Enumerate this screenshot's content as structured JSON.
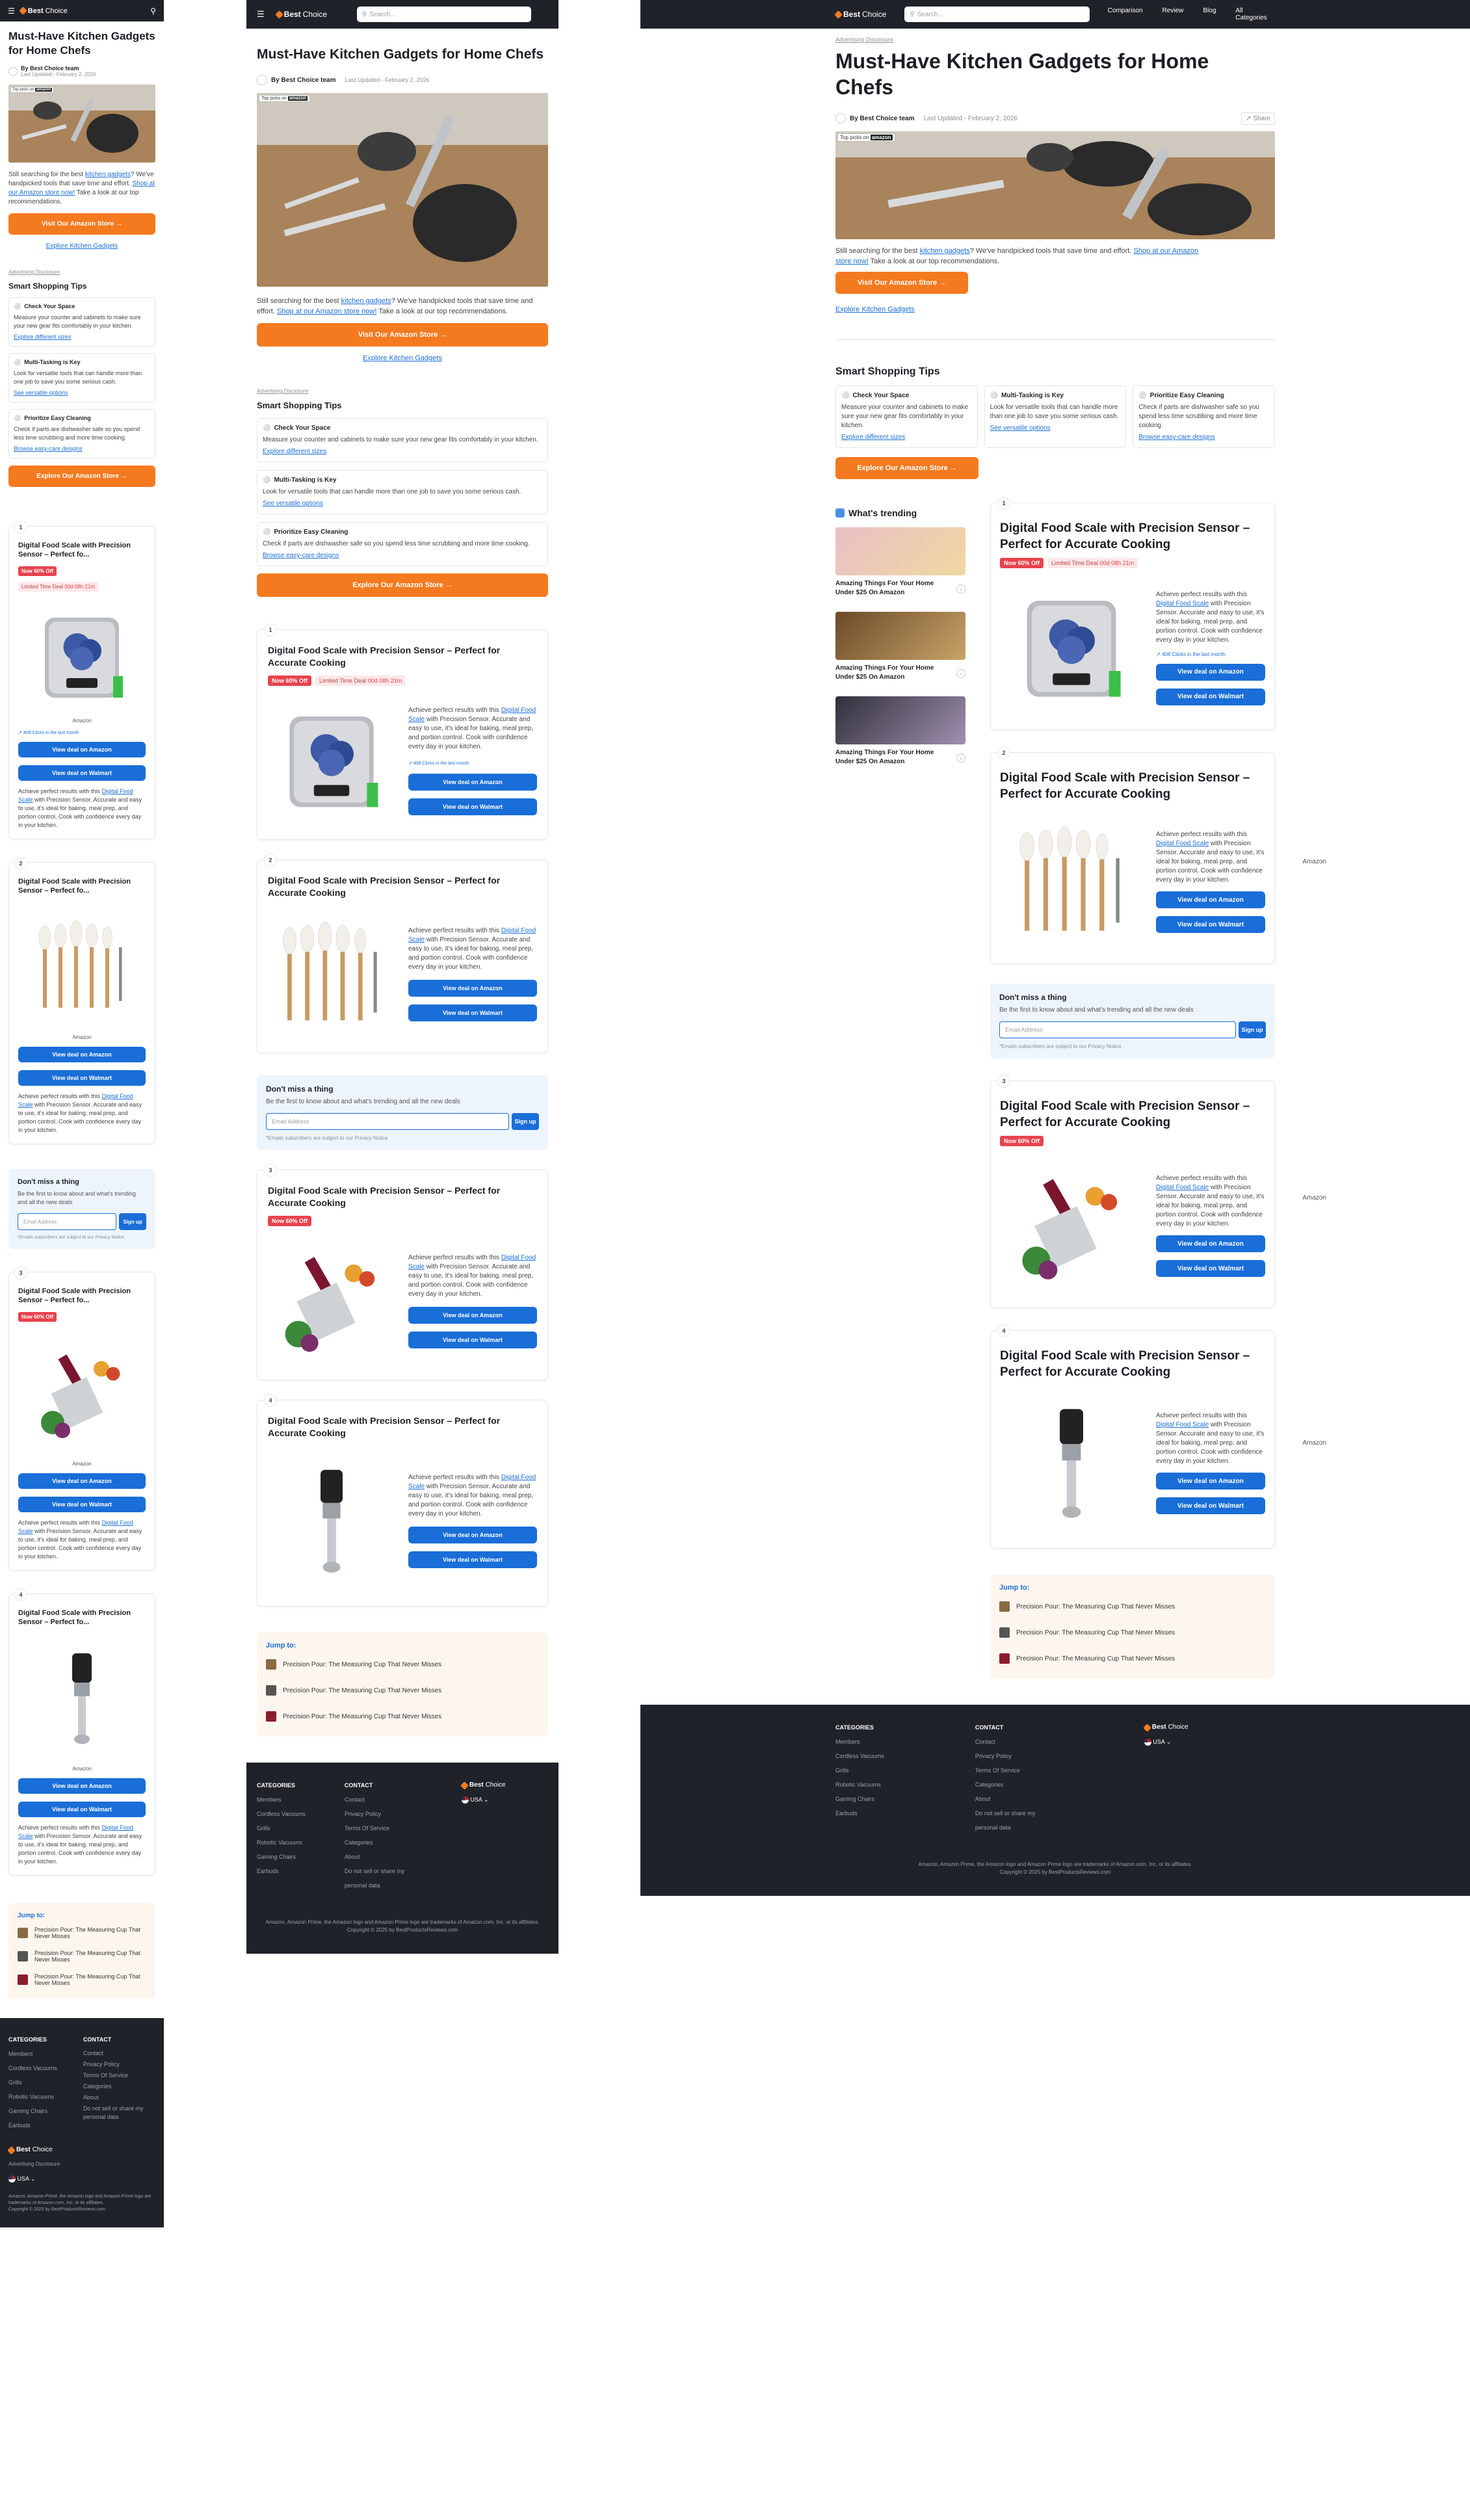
{
  "brand": {
    "name_bold": "Best",
    "name_light": "Choice"
  },
  "search": {
    "placeholder": "Search..."
  },
  "nav": [
    "Comparison",
    "Review",
    "Blog",
    "All Categories"
  ],
  "ad_disclosure": "Advertising Disclosure",
  "article": {
    "title": "Must-Have Kitchen Gadgets for Home Chefs",
    "author": "By Best Choice team",
    "updated": "Last Updated - February 2, 2026",
    "share": "Share",
    "top_picks": "Top picks on",
    "amazon_tag": "amazon",
    "intro_a": "Still searching for the best ",
    "intro_link1": "kitchen gadgets",
    "intro_b": "? We've handpicked tools that save time and effort. ",
    "intro_link2": "Shop at our Amazon store now!",
    "intro_c": " Take a look at our top recommendations.",
    "cta": "Visit Our Amazon Store →",
    "explore_link": "Explore Kitchen Gadgets"
  },
  "tips": {
    "heading": "Smart Shopping Tips",
    "items": [
      {
        "title": "Check Your Space",
        "text": "Measure your counter and cabinets to make sure your new gear fits comfortably in your kitchen.",
        "link": "Explore different sizes"
      },
      {
        "title": "Multi-Tasking is Key",
        "text": "Look for versatile tools that can handle more than one job to save you some serious cash.",
        "link": "See versatile options"
      },
      {
        "title": "Prioritize Easy Cleaning",
        "text": "Check if parts are dishwasher safe so you spend less time scrubbing and more time cooking.",
        "link": "Browse easy-care designs"
      }
    ],
    "cta": "Explore Our Amazon Store →"
  },
  "trending": {
    "heading": "What's trending",
    "items": [
      "Amazing Things For Your Home Under $25 On Amazon",
      "Amazing Things For Your Home Under $25 On Amazon",
      "Amazing Things For Your Home Under $25 On Amazon"
    ]
  },
  "products": [
    {
      "rank": "1",
      "title": "Digital Food Scale with Precision Sensor – Perfect for Accurate Cooking",
      "short": "Digital Food Scale with Precision Sensor – Perfect fo...",
      "badge": "Now 60% Off",
      "deal": "Limited Time Deal",
      "timer": "00d 08h 21m",
      "clicks": "408 Clicks in the last month",
      "brand": "Amazon",
      "desc_a": "Achieve perfect results with this ",
      "desc_link": "Digital Food Scale",
      "desc_b": " with Precision Sensor. Accurate and easy to use, it's ideal for baking, meal prep, and portion control. Cook with confidence every day in your kitchen.",
      "btn_amazon": "View deal on Amazon",
      "btn_walmart": "View deal on Walmart"
    },
    {
      "rank": "2",
      "title": "Digital Food Scale with Precision Sensor – Perfect for Accurate Cooking",
      "short": "Digital Food Scale with Precision Sensor – Perfect fo...",
      "brand": "Amazon",
      "desc_a": "Achieve perfect results with this ",
      "desc_link": "Digital Food Scale",
      "desc_b": " with Precision Sensor. Accurate and easy to use, it's ideal for baking, meal prep, and portion control. Cook with confidence every day in your kitchen.",
      "btn_amazon": "View deal on Amazon",
      "btn_walmart": "View deal on Walmart"
    },
    {
      "rank": "3",
      "title": "Digital Food Scale with Precision Sensor – Perfect for Accurate Cooking",
      "short": "Digital Food Scale with Precision Sensor – Perfect fo...",
      "badge": "Now 60% Off",
      "brand": "Amazon",
      "desc_a": "Achieve perfect results with this ",
      "desc_link": "Digital Food Scale",
      "desc_b": " with Precision Sensor. Accurate and easy to use, it's ideal for baking, meal prep, and portion control. Cook with confidence every day in your kitchen.",
      "btn_amazon": "View deal on Amazon",
      "btn_walmart": "View deal on Walmart"
    },
    {
      "rank": "4",
      "title": "Digital Food Scale with Precision Sensor – Perfect for Accurate Cooking",
      "short": "Digital Food Scale with Precision Sensor – Perfect fo...",
      "brand": "Amazon",
      "desc_a": "Achieve perfect results with this ",
      "desc_link": "Digital Food Scale",
      "desc_b": " with Precision Sensor. Accurate and easy to use, it's ideal for baking, meal prep, and portion control. Cook with confidence every day in your kitchen.",
      "btn_amazon": "View deal on Amazon",
      "btn_walmart": "View deal on Walmart"
    }
  ],
  "newsletter": {
    "title": "Don't miss a thing",
    "text": "Be the first to know about and what's trending and all the new deals",
    "placeholder": "Email Address",
    "button": "Sign up",
    "note": "*Emails subscribers are subject to our Privacy Notice"
  },
  "jump": {
    "title": "Jump to:",
    "items": [
      "Precision Pour: The Measuring Cup That Never Misses",
      "Precision Pour: The Measuring Cup That Never Misses",
      "Precision Pour: The Measuring Cup That Never Misses"
    ]
  },
  "footer": {
    "categories_h": "CATEGORIES",
    "categories": [
      "Members",
      "Cordless Vacuums",
      "Grills",
      "Robotic Vacuums",
      "Gaming Chairs",
      "Earbuds"
    ],
    "contact_h": "CONTACT",
    "contact": [
      "Contact",
      "Privacy Policy",
      "Terms Of Service",
      "Categories",
      "About",
      "Do not sell or share my personal data"
    ],
    "country": "USA",
    "disclosure": "Advertising Disclosure",
    "legal": "Amazon, Amazon Prime, the Amazon logo and Amazon Prime logo are trademarks of Amazon.com, Inc. or its affiliates.",
    "copyright": "Copyright © 2025 by BestProductsReviews.com"
  },
  "colors": {
    "accent": "#f47a20",
    "link": "#1a6ed8",
    "sale": "#e8434d",
    "dark": "#1f2329"
  }
}
